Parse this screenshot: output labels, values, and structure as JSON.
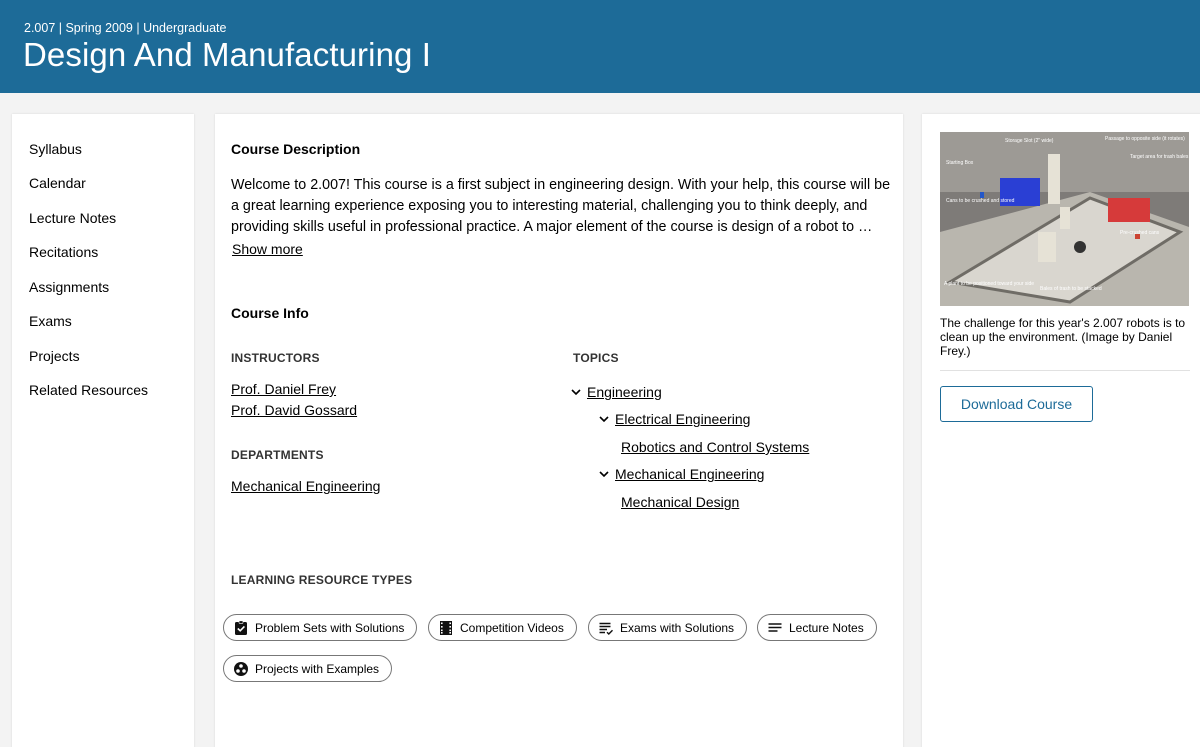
{
  "header": {
    "meta": "2.007 | Spring 2009 | Undergraduate",
    "title": "Design And Manufacturing I"
  },
  "sidebar": {
    "items": [
      {
        "label": "Syllabus"
      },
      {
        "label": "Calendar"
      },
      {
        "label": "Lecture Notes"
      },
      {
        "label": "Recitations"
      },
      {
        "label": "Assignments"
      },
      {
        "label": "Exams"
      },
      {
        "label": "Projects"
      },
      {
        "label": "Related Resources"
      }
    ]
  },
  "main": {
    "description_title": "Course Description",
    "description_text": "Welcome to 2.007! This course is a first subject in engineering design. With your help, this course will be a great learning experience exposing you to interesting material, challenging you to think deeply, and providing skills useful in professional practice. A major element of the course is design of a robot to …",
    "show_more": "Show more",
    "info_title": "Course Info",
    "instructors_label": "INSTRUCTORS",
    "instructors": [
      "Prof. Daniel Frey",
      "Prof. David Gossard"
    ],
    "departments_label": "DEPARTMENTS",
    "departments": [
      "Mechanical Engineering"
    ],
    "topics_label": "TOPICS",
    "topics": {
      "engineering": "Engineering",
      "electrical": "Electrical Engineering",
      "robotics": "Robotics and Control Systems",
      "mechanical": "Mechanical Engineering",
      "mech_design": "Mechanical Design"
    },
    "lrt_label": "LEARNING RESOURCE TYPES",
    "resource_types": [
      {
        "label": "Problem Sets with Solutions",
        "icon": "assignment-check-icon"
      },
      {
        "label": "Competition Videos",
        "icon": "film-icon"
      },
      {
        "label": "Exams with Solutions",
        "icon": "exam-list-icon"
      },
      {
        "label": "Lecture Notes",
        "icon": "notes-lines-icon"
      },
      {
        "label": "Projects with Examples",
        "icon": "projects-cluster-icon"
      }
    ]
  },
  "aside": {
    "photo_labels": {
      "storage": "Storage Slot (2\" wide)",
      "passage": "Passage to opposite side (it rotates)",
      "target": "Target area for trash bales",
      "starting": "Starting Box",
      "cans": "Cans to be crushed and stored",
      "precrushed": "Pre-crushed cans",
      "plant": "A plant to be positioned toward your side",
      "bales": "Bales of trash to be stacked"
    },
    "caption": "The challenge for this year's 2.007 robots is to clean up the environment. (Image by Daniel Frey.)",
    "download_label": "Download Course"
  },
  "colors": {
    "brand": "#1d6b98",
    "page_bg": "#f3f3f3"
  }
}
